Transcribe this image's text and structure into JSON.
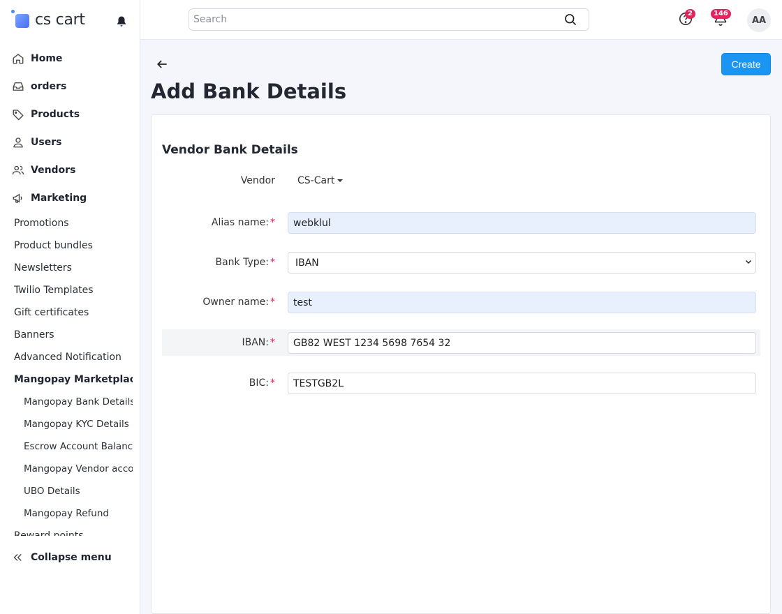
{
  "app": {
    "logo_text": "cs cart"
  },
  "search": {
    "placeholder": "Search"
  },
  "topbar": {
    "help_badge": "2",
    "notifications_badge": "146",
    "avatar_initials": "AA"
  },
  "sidebar": {
    "main": [
      {
        "label": "Home",
        "icon": "home-icon"
      },
      {
        "label": "orders",
        "icon": "inbox-icon"
      },
      {
        "label": "Products",
        "icon": "tag-icon"
      },
      {
        "label": "Users",
        "icon": "user-icon"
      },
      {
        "label": "Vendors",
        "icon": "users-icon"
      },
      {
        "label": "Marketing",
        "icon": "megaphone-icon"
      }
    ],
    "sub": [
      "Promotions",
      "Product bundles",
      "Newsletters",
      "Twilio Templates",
      "Gift certificates",
      "Banners",
      "Advanced Notification",
      "Mangopay Marketplace",
      "Mangopay Bank Details",
      "Mangopay KYC Details",
      "Escrow Account Balance",
      "Mangopay Vendor acco…",
      "UBO Details",
      "Mangopay Refund",
      "Reward points"
    ],
    "collapse_label": "Collapse menu"
  },
  "page": {
    "title": "Add Bank Details",
    "create_label": "Create"
  },
  "form": {
    "section_title": "Vendor Bank Details",
    "vendor_label": "Vendor",
    "vendor_value": "CS-Cart",
    "alias_label": "Alias name:",
    "alias_value": "webklul",
    "bank_type_label": "Bank Type:",
    "bank_type_value": "IBAN",
    "owner_label": "Owner name:",
    "owner_value": "test",
    "iban_label": "IBAN:",
    "iban_value": "GB82 WEST 1234 5698 7654 32",
    "bic_label": "BIC:",
    "bic_value": "TESTGB2L",
    "required_mark": "*"
  },
  "colors": {
    "accent": "#1a95f2",
    "badge": "#e0245e",
    "autofill": "#e8f0fe"
  }
}
